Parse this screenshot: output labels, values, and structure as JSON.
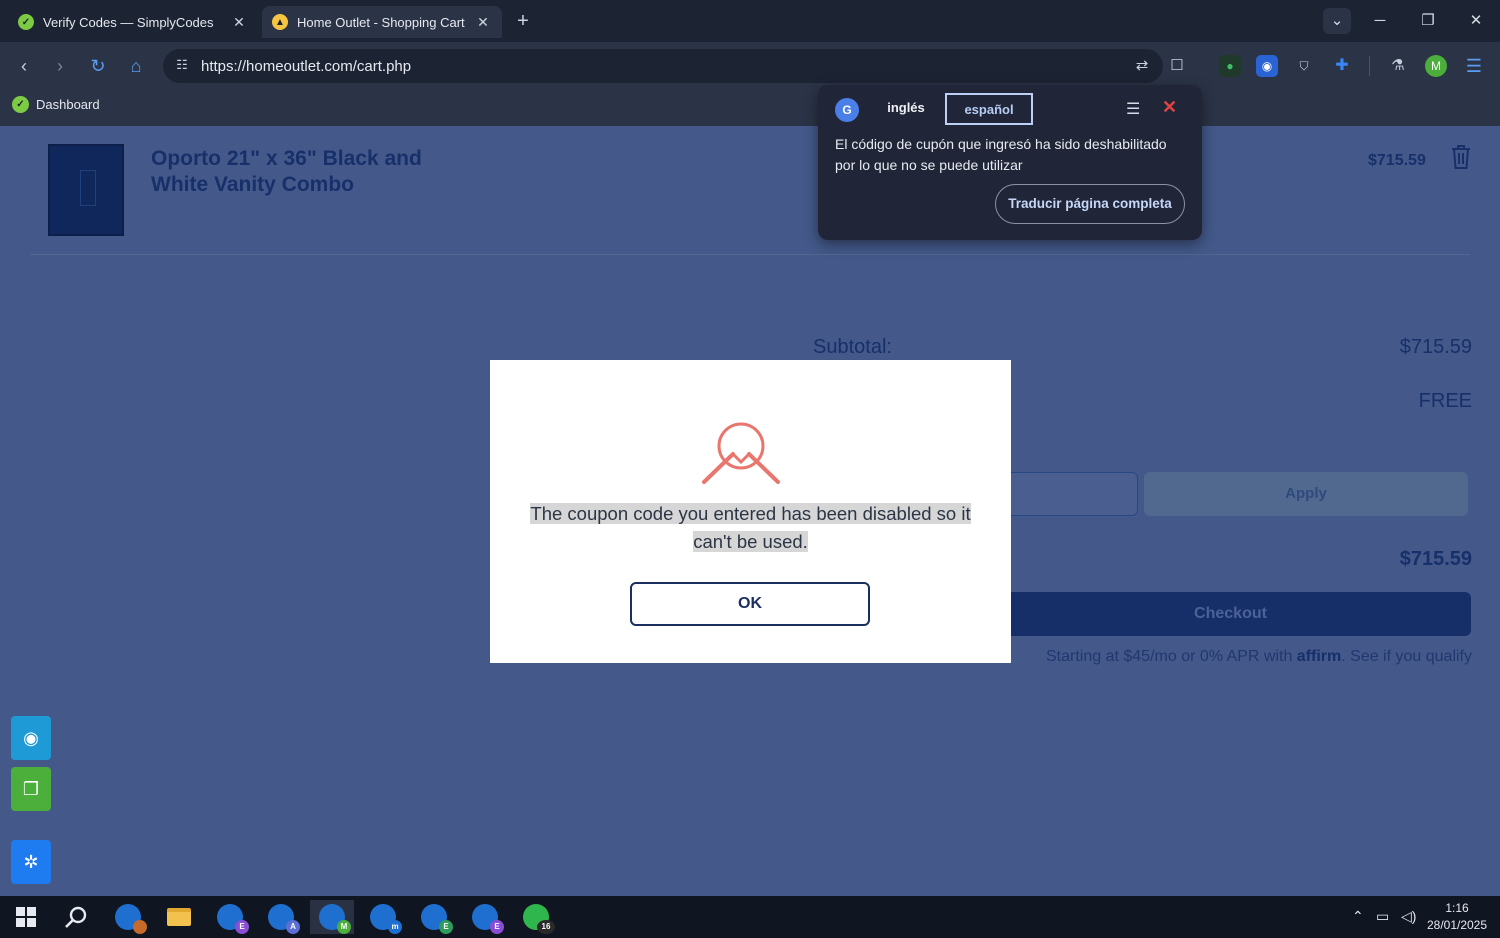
{
  "browser": {
    "tabs": [
      {
        "title": "Verify Codes — SimplyCodes",
        "active": false,
        "favicon_color": "#7ccb43"
      },
      {
        "title": "Home Outlet - Shopping Cart",
        "active": true,
        "favicon_color": "#f5c542"
      }
    ],
    "url": "https://homeoutlet.com/cart.php",
    "bookmarks": [
      {
        "label": "Dashboard"
      }
    ],
    "extensions": [
      {
        "icon": "leaf-extension-icon",
        "color": "#2f9c5a"
      },
      {
        "icon": "shield-blue-extension-icon",
        "color": "#2a63d6"
      },
      {
        "icon": "shield-extension-icon",
        "color": "#8c93a3"
      },
      {
        "icon": "puzzle-icon",
        "color": "#3b86f0"
      },
      {
        "icon": "flask-icon",
        "color": "#c9d0dc"
      },
      {
        "icon": "profile-avatar",
        "color": "#4cae3b",
        "letter": "M"
      }
    ]
  },
  "translate_popup": {
    "source_lang": "inglés",
    "target_lang": "español",
    "translated_text": "El código de cupón que ingresó ha sido deshabilitado por lo que no se puede utilizar",
    "full_page_button": "Traducir página completa"
  },
  "cart": {
    "item": {
      "name": "Oporto 21\" x 36\" Black and White Vanity Combo",
      "price": "$715.59"
    },
    "subtotal_label": "Subtotal:",
    "subtotal_value": "$715.59",
    "shipping_value": "FREE",
    "apply_label": "Apply",
    "total_value": "$715.59",
    "checkout_label": "Checkout",
    "financing": {
      "prefix": "Starting at $45/mo or 0% APR with",
      "brand": "affirm",
      "suffix": ". See if you qualify"
    }
  },
  "modal": {
    "message": "The coupon code you entered has been disabled so it can't be used.",
    "ok_label": "OK",
    "icon": "search-error-icon",
    "icon_color": "#e8766f"
  },
  "side_widgets": [
    {
      "icon": "eye-icon",
      "color": "#1e9bd7"
    },
    {
      "icon": "copy-icon",
      "color": "#4cae3b"
    },
    {
      "icon": "gear-icon",
      "color": "#1e7cf0"
    }
  ],
  "taskbar": {
    "apps": [
      {
        "icon": "start-icon"
      },
      {
        "icon": "search-icon"
      },
      {
        "icon": "edge-profile-icon",
        "badge_color": "#c56a2a",
        "badge": ""
      },
      {
        "icon": "file-explorer-icon"
      },
      {
        "icon": "edge-profile-icon",
        "badge_color": "#8a4dd6",
        "badge": "E"
      },
      {
        "icon": "edge-profile-icon",
        "badge_color": "#5b6fd6",
        "badge": "A"
      },
      {
        "icon": "edge-profile-icon",
        "badge_color": "#4cae3b",
        "badge": "M",
        "active": true
      },
      {
        "icon": "edge-profile-icon",
        "badge_color": "#1e6fd0",
        "badge": "m"
      },
      {
        "icon": "edge-profile-icon",
        "badge_color": "#2f9c5a",
        "badge": "E"
      },
      {
        "icon": "edge-profile-icon",
        "badge_color": "#8a4dd6",
        "badge": "E"
      },
      {
        "icon": "whatsapp-icon",
        "badge_color": "#2a2a2a",
        "badge": "16"
      }
    ],
    "time": "1:16",
    "date": "28/01/2025"
  }
}
